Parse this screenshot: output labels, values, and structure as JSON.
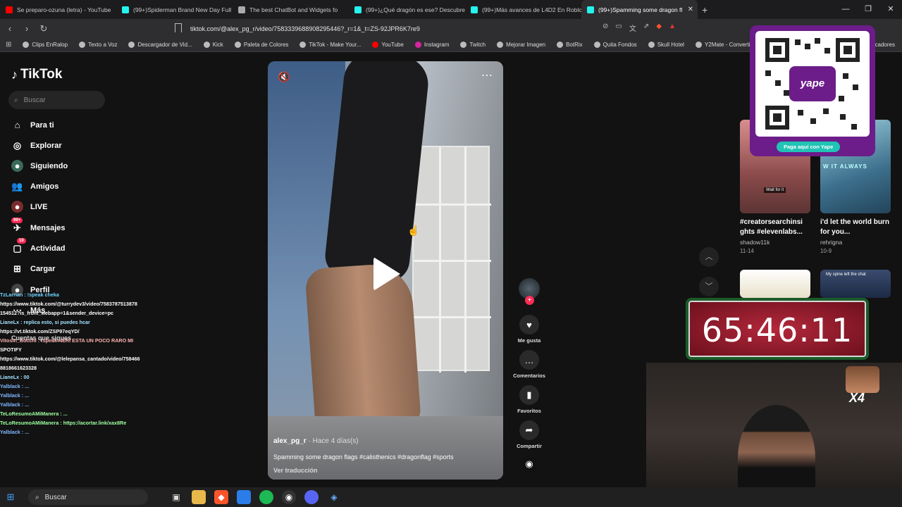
{
  "browser": {
    "tabs": [
      {
        "title": "Se preparo-ozuna (letra) - YouTube",
        "fav": "#ff0000"
      },
      {
        "title": "(99+)Spiderman Brand New Day Full",
        "fav": "#25f4ee"
      },
      {
        "title": "The best ChatBot and Widgets fo",
        "fav": "#aaaaaa"
      },
      {
        "title": "(99+)¿Qué dragón es ese? Descubre",
        "fav": "#25f4ee"
      },
      {
        "title": "(99+)Más avances de L4D2 En Roblo",
        "fav": "#25f4ee"
      },
      {
        "title": "(99+)Spamming some dragon fl",
        "fav": "#25f4ee",
        "active": true
      }
    ],
    "new_tab": "+",
    "url": "tiktok.com/@alex_pg_r/video/7583339688908295446?_r=1&_t=ZS-92JPR6K7re9",
    "bookmarks": [
      "Clips EnRalop",
      "Texto a Voz",
      "Descargador de Vid...",
      "Kick",
      "Paleta de Colores",
      "TikTok - Make Your...",
      "YouTube",
      "Instagram",
      "Twitch",
      "Mejorar Imagen",
      "BotRix",
      "Quita Fondos",
      "Skull Hotel",
      "Y2Mate - Convertid..."
    ],
    "bookmarks_overflow": "cadores"
  },
  "sidebar": {
    "logo": "TikTok",
    "search_placeholder": "Buscar",
    "items": [
      {
        "label": "Para ti",
        "icon": "home-icon"
      },
      {
        "label": "Explorar",
        "icon": "compass-icon"
      },
      {
        "label": "Siguiendo",
        "icon": "following-avatar-icon"
      },
      {
        "label": "Amigos",
        "icon": "friends-icon"
      },
      {
        "label": "LIVE",
        "icon": "live-icon"
      },
      {
        "label": "Mensajes",
        "icon": "messages-icon",
        "badge": "99+"
      },
      {
        "label": "Actividad",
        "icon": "activity-icon",
        "badge": "10"
      },
      {
        "label": "Cargar",
        "icon": "upload-icon"
      },
      {
        "label": "Perfil",
        "icon": "profile-icon"
      },
      {
        "label": "Más",
        "icon": "more-icon"
      }
    ],
    "following_header": "Cuentas que sigues"
  },
  "chat_overlay": [
    "TzLarrian : !speak cheka",
    "https://www.tiktok.com/@turrydev3/video/7583787513878",
    "154512?is_from_webapp=1&sender_device=pc",
    "LianeLx : replica esto, si puedes hcar",
    "https://vt.tiktok.com/ZSP97eqYD/",
    "Vitosin_Bocchi : !speak NERI ESTA UN POCO RARO MI",
    "SPOTIFY",
    "https://www.tiktok.com/@lelepansa_cantado/video/758466",
    "8818661623328",
    "LianeLx : 00",
    "Yalblack : ...",
    "Yalblack : ...",
    "Yalblack : ...",
    "TeLoResumoAMiManera : ...",
    "TeLoResumoAMiManera : https://acortar.link/xax8Re",
    "Yalblack : ..."
  ],
  "video": {
    "author": "alex_pg_r",
    "time_ago": "· Hace 4 días(s)",
    "caption": "Spamming some dragon flags #calisthenics #dragonflag #sports",
    "translate": "Ver traducción"
  },
  "actions": [
    {
      "label": "Me gusta",
      "icon": "heart-icon"
    },
    {
      "label": "Comentarios",
      "icon": "comment-icon"
    },
    {
      "label": "Favoritos",
      "icon": "bookmark-icon"
    },
    {
      "label": "Compartir",
      "icon": "share-icon"
    }
  ],
  "right_cards": [
    {
      "title": "#creatorsearchinsi ghts #elevenlabs...",
      "user": "shadow11k",
      "date": "11-14",
      "thumb_text": "Wait for it"
    },
    {
      "title": "i'd let the world burn for you...",
      "user": "rehrigna",
      "date": "10-9",
      "thumb_text": "W IT ALWAYS"
    },
    {
      "title": "",
      "user": "",
      "date": "",
      "thumb_text": ""
    },
    {
      "title": "",
      "user": "",
      "date": "",
      "thumb_text": "My spine left the chat"
    }
  ],
  "overlay": {
    "qr_caption": "Paga aquí con Yape",
    "qr_brand": "yape",
    "timer": "65:46:11",
    "cam_multiplier": "X4"
  },
  "taskbar": {
    "search_label": "Buscar"
  },
  "colors": {
    "accent": "#fe2c55",
    "yape_purple": "#6c1d8a",
    "background": "#121212"
  }
}
